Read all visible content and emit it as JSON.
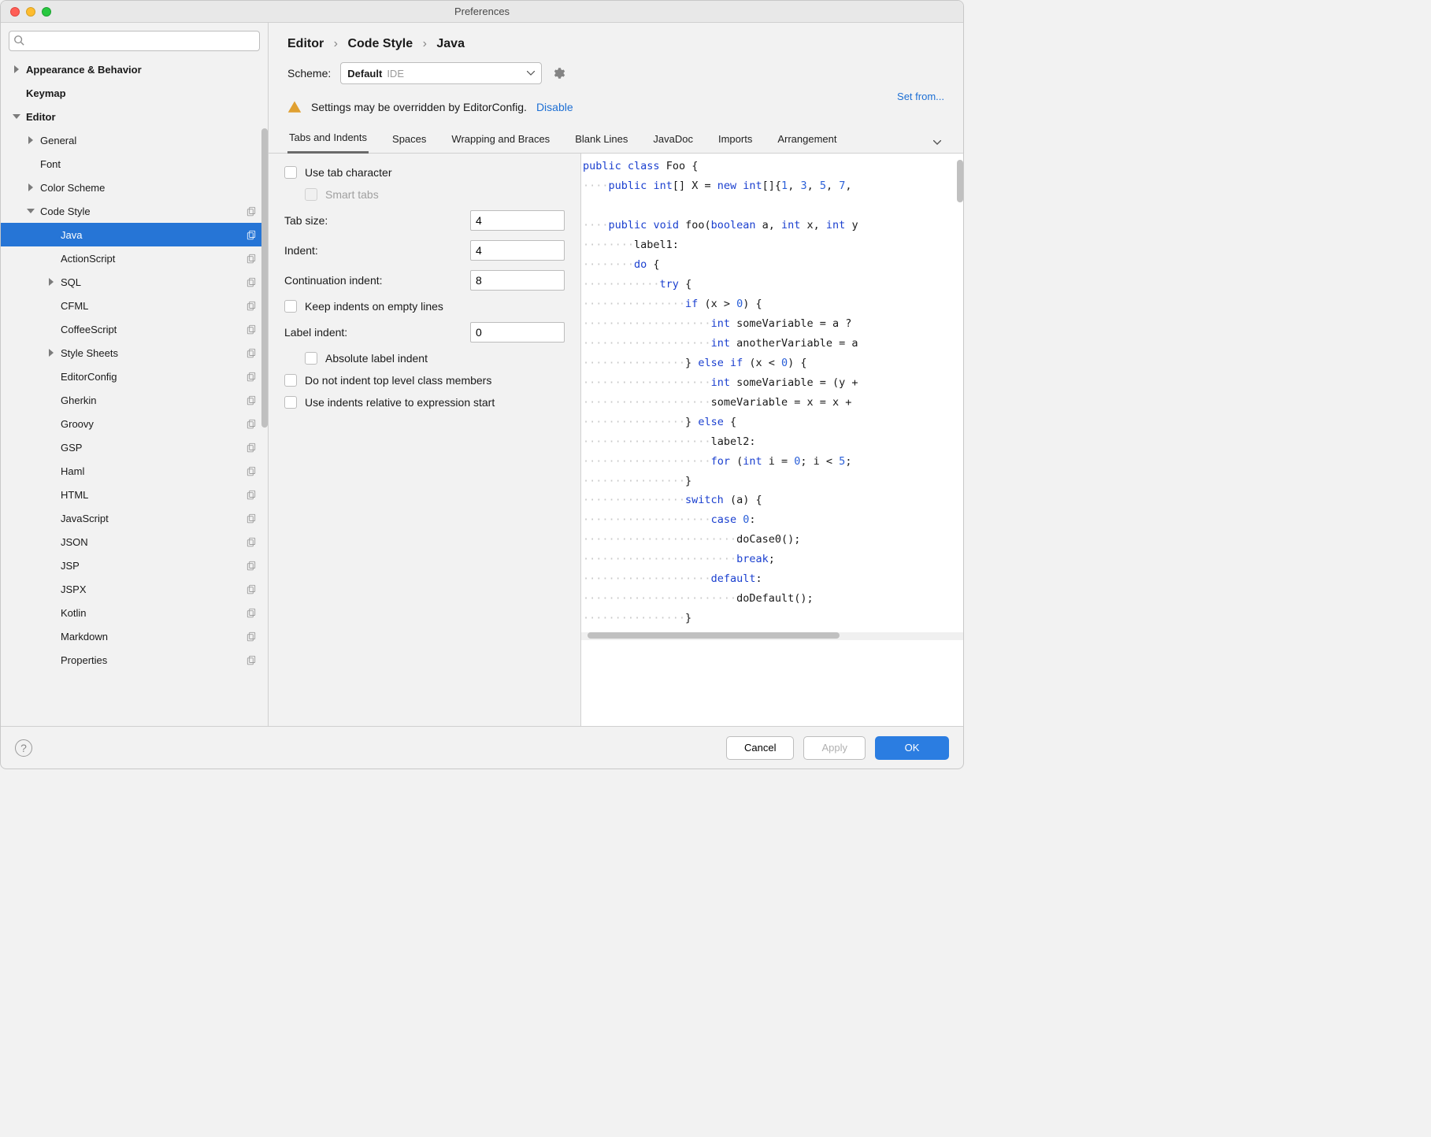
{
  "window": {
    "title": "Preferences"
  },
  "search": {
    "placeholder": ""
  },
  "sidebar": {
    "items": [
      {
        "label": "Appearance & Behavior",
        "level": 0,
        "arrow": "right",
        "bold": true
      },
      {
        "label": "Keymap",
        "level": 0,
        "arrow": "none",
        "bold": true
      },
      {
        "label": "Editor",
        "level": 0,
        "arrow": "down",
        "bold": true
      },
      {
        "label": "General",
        "level": 1,
        "arrow": "right"
      },
      {
        "label": "Font",
        "level": 1,
        "arrow": "none"
      },
      {
        "label": "Color Scheme",
        "level": 1,
        "arrow": "right"
      },
      {
        "label": "Code Style",
        "level": 1,
        "arrow": "down",
        "copy": true
      },
      {
        "label": "Java",
        "level": 2,
        "arrow": "none",
        "copy": true,
        "selected": true
      },
      {
        "label": "ActionScript",
        "level": 2,
        "arrow": "none",
        "copy": true
      },
      {
        "label": "SQL",
        "level": 2,
        "arrow": "right",
        "copy": true
      },
      {
        "label": "CFML",
        "level": 2,
        "arrow": "none",
        "copy": true
      },
      {
        "label": "CoffeeScript",
        "level": 2,
        "arrow": "none",
        "copy": true
      },
      {
        "label": "Style Sheets",
        "level": 2,
        "arrow": "right",
        "copy": true
      },
      {
        "label": "EditorConfig",
        "level": 2,
        "arrow": "none",
        "copy": true
      },
      {
        "label": "Gherkin",
        "level": 2,
        "arrow": "none",
        "copy": true
      },
      {
        "label": "Groovy",
        "level": 2,
        "arrow": "none",
        "copy": true
      },
      {
        "label": "GSP",
        "level": 2,
        "arrow": "none",
        "copy": true
      },
      {
        "label": "Haml",
        "level": 2,
        "arrow": "none",
        "copy": true
      },
      {
        "label": "HTML",
        "level": 2,
        "arrow": "none",
        "copy": true
      },
      {
        "label": "JavaScript",
        "level": 2,
        "arrow": "none",
        "copy": true
      },
      {
        "label": "JSON",
        "level": 2,
        "arrow": "none",
        "copy": true
      },
      {
        "label": "JSP",
        "level": 2,
        "arrow": "none",
        "copy": true
      },
      {
        "label": "JSPX",
        "level": 2,
        "arrow": "none",
        "copy": true
      },
      {
        "label": "Kotlin",
        "level": 2,
        "arrow": "none",
        "copy": true
      },
      {
        "label": "Markdown",
        "level": 2,
        "arrow": "none",
        "copy": true
      },
      {
        "label": "Properties",
        "level": 2,
        "arrow": "none",
        "copy": true
      }
    ]
  },
  "breadcrumb": {
    "c1": "Editor",
    "c2": "Code Style",
    "c3": "Java"
  },
  "scheme": {
    "label": "Scheme:",
    "name": "Default",
    "kind": "IDE"
  },
  "setfrom": "Set from...",
  "warning": {
    "text": "Settings may be overridden by EditorConfig.",
    "action": "Disable"
  },
  "tabs": [
    "Tabs and Indents",
    "Spaces",
    "Wrapping and Braces",
    "Blank Lines",
    "JavaDoc",
    "Imports",
    "Arrangement"
  ],
  "form": {
    "use_tab": "Use tab character",
    "smart_tabs": "Smart tabs",
    "tab_size_lbl": "Tab size:",
    "tab_size_val": "4",
    "indent_lbl": "Indent:",
    "indent_val": "4",
    "cont_lbl": "Continuation indent:",
    "cont_val": "8",
    "keep_empty": "Keep indents on empty lines",
    "label_indent_lbl": "Label indent:",
    "label_indent_val": "0",
    "abs_label": "Absolute label indent",
    "no_indent_top": "Do not indent top level class members",
    "relative": "Use indents relative to expression start"
  },
  "footer": {
    "cancel": "Cancel",
    "apply": "Apply",
    "ok": "OK"
  }
}
